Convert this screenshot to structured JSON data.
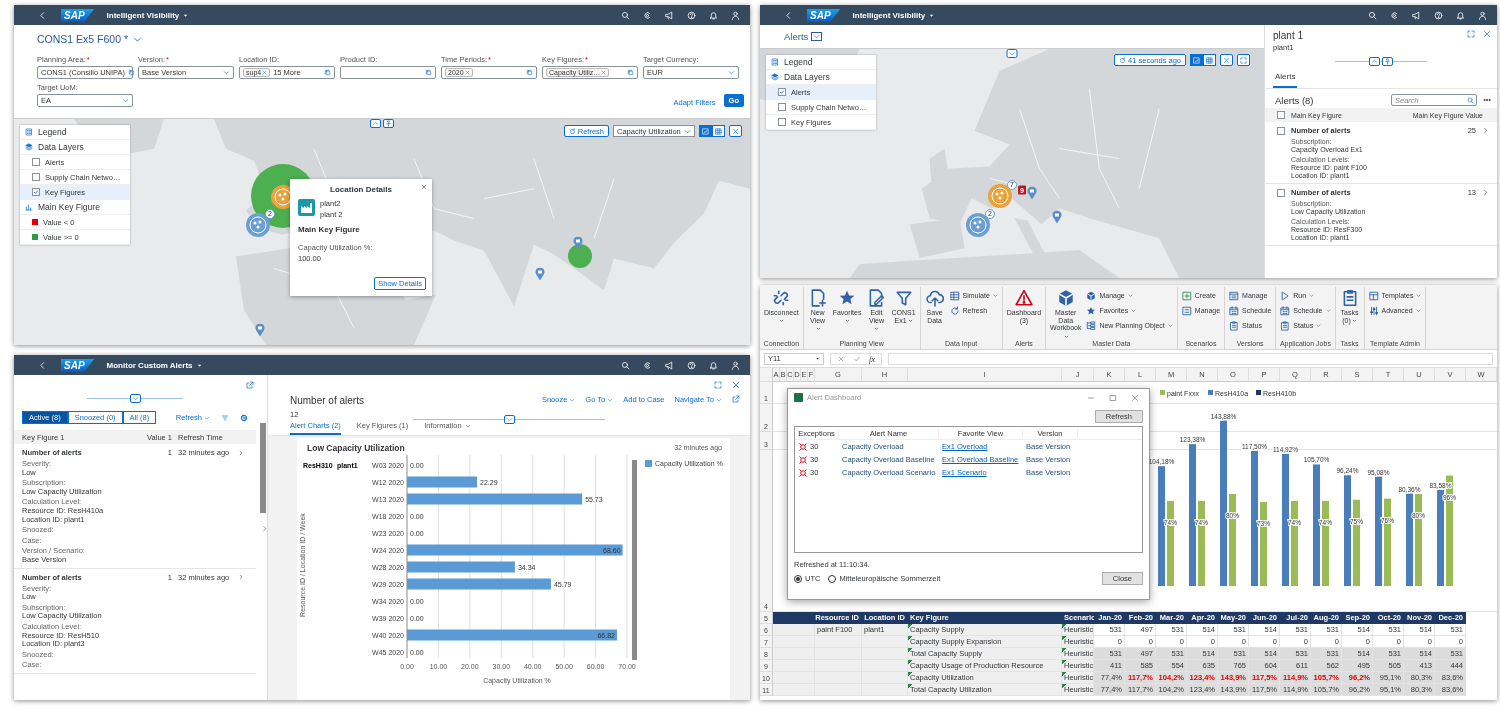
{
  "map_view": {
    "shell": {
      "logo": "SAP",
      "title": "Intelligent Visibility"
    },
    "title": "CONS1 Ex5 F600 *",
    "filters": [
      {
        "label": "Planning Area:",
        "required_mark": "*",
        "kind": "value-help",
        "value": "CONS1 (Consilio UNIPA)"
      },
      {
        "label": "Version:",
        "required_mark": "*",
        "kind": "select",
        "value": "Base Version"
      },
      {
        "label": "Location ID:",
        "kind": "tokens",
        "tokens": [
          "sup4"
        ],
        "more": "15 More"
      },
      {
        "label": "Product ID:",
        "kind": "value-help"
      },
      {
        "label": "Time Periods:",
        "required_mark": "*",
        "kind": "tokens",
        "tokens": [
          "2020"
        ]
      },
      {
        "label": "Key Figures:",
        "required_mark": "*",
        "kind": "tokens",
        "tokens": [
          "Capacity Utiliz…"
        ]
      },
      {
        "label": "Target Currency:",
        "kind": "select",
        "value": "EUR"
      },
      {
        "label": "Target UoM:",
        "kind": "select",
        "value": "EA"
      }
    ],
    "adapt_filters": "Adapt Filters",
    "go": "Go",
    "toolbar": {
      "refresh": "Refresh",
      "measure": "Capacity Utilization",
      "views": [
        {
          "kind": "chart",
          "selected": true
        },
        {
          "kind": "table",
          "selected": false
        }
      ]
    },
    "legend": {
      "title": "Legend",
      "layers_title": "Data Layers",
      "layers": [
        {
          "label": "Alerts",
          "checked": false,
          "selected": false
        },
        {
          "label": "Supply Chain Netwo…",
          "checked": false,
          "selected": false
        },
        {
          "label": "Key Figures",
          "checked": true,
          "selected": true
        }
      ],
      "key_title": "Main Key Figure",
      "keys": [
        {
          "label": "Value < 0",
          "color": "#e00000"
        },
        {
          "label": "Value >= 0",
          "color": "#2e9e44"
        }
      ]
    },
    "markers": [
      {
        "kind": "bubble",
        "color": "#4caf50"
      },
      {
        "kind": "dot",
        "color": "#4caf50"
      },
      {
        "kind": "pin",
        "color": "#5b8fc7"
      },
      {
        "kind": "cluster",
        "color": "#e8a33c"
      },
      {
        "kind": "cluster",
        "color": "#6a9fd4",
        "count": "2"
      },
      {
        "kind": "pin",
        "color": "#5b8fc7"
      },
      {
        "kind": "pin",
        "color": "#5b8fc7"
      }
    ],
    "popover": {
      "title": "Location Details",
      "name": "plant2",
      "description": "plant 2",
      "section": "Main Key Figure",
      "field": "Capacity Utilization %:",
      "value": "100.00",
      "button": "Show Details"
    }
  },
  "alerts_map": {
    "shell": {
      "logo": "SAP",
      "title": "Intelligent Visibility"
    },
    "title": "Alerts",
    "refreshed": "41 seconds ago",
    "views": [
      {
        "kind": "chart",
        "selected": true
      },
      {
        "kind": "table",
        "selected": false
      }
    ],
    "legend": {
      "title": "Legend",
      "layers_title": "Data Layers",
      "layers": [
        {
          "label": "Alerts",
          "checked": true,
          "selected": true
        },
        {
          "label": "Supply Chain Netwo…",
          "checked": false,
          "selected": false
        },
        {
          "label": "Key Figures",
          "checked": false,
          "selected": false
        }
      ]
    },
    "markers": [
      {
        "kind": "cluster",
        "color": "#e8a33c",
        "count": "7"
      },
      {
        "kind": "alert",
        "color": "#c0131d",
        "count": "9"
      },
      {
        "kind": "pin",
        "color": "#5b8fc7"
      },
      {
        "kind": "pin",
        "color": "#5b8fc7"
      },
      {
        "kind": "cluster",
        "color": "#6a9fd4",
        "count": "2"
      }
    ],
    "details": {
      "title": "plant 1",
      "subtitle": "plant1",
      "tabs": [
        {
          "label": "Alerts",
          "selected": true
        }
      ],
      "list_title": "Alerts (8)",
      "search_placeholder": "Search",
      "select_all": {
        "checked": false
      },
      "columns": [
        "Main Key Figure",
        "Main Key Figure Value"
      ],
      "items": [
        {
          "title": "Number of alerts",
          "value": "25",
          "checked": false,
          "fields": [
            {
              "label": "Subscription:",
              "values": [
                "Capacity Overload Ex1"
              ]
            },
            {
              "label": "Calculation Levels:",
              "values": [
                "Resource ID: paint F100",
                "Location ID: plant1"
              ]
            }
          ]
        },
        {
          "title": "Number of alerts",
          "value": "13",
          "checked": false,
          "fields": [
            {
              "label": "Subscription:",
              "values": [
                "Low Capacity Utilization"
              ]
            },
            {
              "label": "Calculation Levels:",
              "values": [
                "Resource ID: ResF300",
                "Location ID: plant1"
              ]
            }
          ]
        }
      ]
    }
  },
  "monitor": {
    "shell": {
      "logo": "SAP",
      "title": "Monitor Custom Alerts"
    },
    "segments": [
      {
        "label": "Active (8)",
        "selected": true
      },
      {
        "label": "Snoozed (0)",
        "selected": false
      },
      {
        "label": "All (8)",
        "selected": false
      }
    ],
    "refresh": "Refresh",
    "columns": [
      "Key Figure 1",
      "Value 1",
      "Refresh Time"
    ],
    "items": [
      {
        "title": "Number of alerts",
        "value": "1",
        "time": "32 minutes ago",
        "fields": [
          {
            "label": "Severity:",
            "values": [
              "Low"
            ]
          },
          {
            "label": "Subscription:",
            "values": [
              "Low Capacity Utilization"
            ]
          },
          {
            "label": "Calculation Level:",
            "values": [
              "Resource ID: ResH410a",
              "Location ID: plant1"
            ]
          },
          {
            "label": "Snoozed:"
          },
          {
            "label": "Case:"
          },
          {
            "label": "Version / Scenario:",
            "values": [
              "Base Version"
            ]
          }
        ]
      },
      {
        "title": "Number of alerts",
        "value": "1",
        "time": "32 minutes ago",
        "fields": [
          {
            "label": "Severity:",
            "values": [
              "Low"
            ]
          },
          {
            "label": "Subscription:",
            "values": [
              "Low Capacity Utilization"
            ]
          },
          {
            "label": "Calculation Level:",
            "values": [
              "Resource ID: ResH510",
              "Location ID: plant3"
            ]
          },
          {
            "label": "Snoozed:"
          },
          {
            "label": "Case:"
          }
        ]
      }
    ],
    "detail": {
      "title": "Number of alerts",
      "value": "12",
      "actions": [
        {
          "label": "Snooze",
          "menu": true
        },
        {
          "label": "Go To",
          "menu": true
        },
        {
          "label": "Add to Case",
          "menu": false
        },
        {
          "label": "Navigate To",
          "menu": true
        }
      ],
      "tabs": [
        {
          "label": "Alert Charts (2)",
          "selected": true,
          "menu": false
        },
        {
          "label": "Key Figures (1)",
          "selected": false,
          "menu": false
        },
        {
          "label": "Information",
          "selected": false,
          "menu": true
        }
      ],
      "chart": {
        "title": "Low Capacity Utilization",
        "timestamp": "32 minutes ago",
        "group_labels": [
          "ResH310",
          "plant1"
        ],
        "chart_data": {
          "type": "bar",
          "orientation": "horizontal",
          "xlabel": "Capacity Utilization %",
          "ylabel": "Resource ID / Location ID / Week",
          "categories": [
            "W03 2020",
            "W12 2020",
            "W13 2020",
            "W18 2020",
            "W23 2020",
            "W24 2020",
            "W28 2020",
            "W29 2020",
            "W34 2020",
            "W39 2020",
            "W40 2020",
            "W45 2020"
          ],
          "series": [
            {
              "name": "Capacity Utilization %",
              "color": "#5b9bd5",
              "values": [
                0,
                22.29,
                55.73,
                0,
                0,
                68.6,
                34.34,
                45.79,
                0,
                0,
                66.82,
                0
              ],
              "value_labels": [
                "0.00",
                "22.29",
                "55.73",
                "0.00",
                "0.00",
                "68.60",
                "34.34",
                "45.79",
                "0.00",
                "0.00",
                "66.82",
                "0.00"
              ]
            }
          ],
          "xlim": [
            0,
            70
          ],
          "xticks": [
            {
              "value": 0,
              "label": "0.00"
            },
            {
              "value": 10,
              "label": "10.00"
            },
            {
              "value": 20,
              "label": "20.00"
            },
            {
              "value": 30,
              "label": "30.00"
            },
            {
              "value": 40,
              "label": "40.00"
            },
            {
              "value": 50,
              "label": "50.00"
            },
            {
              "value": 60,
              "label": "60.00"
            },
            {
              "value": 70,
              "label": "70.00"
            }
          ],
          "grid": true,
          "data_labels": true
        }
      }
    }
  },
  "excel": {
    "ribbon": [
      {
        "name": "Connection",
        "items": [
          {
            "label": "Disconnect",
            "large": true,
            "menu": true,
            "kind": "unlink"
          }
        ]
      },
      {
        "name": "Planning View",
        "items": [
          {
            "label": "New View",
            "large": true,
            "menu": true,
            "kind": "newdoc"
          },
          {
            "label": "Favorites",
            "large": true,
            "menu": true,
            "kind": "star"
          },
          {
            "label": "Edit View",
            "large": true,
            "menu": true,
            "kind": "edit"
          },
          {
            "label": "CONS1 Ex1",
            "large": true,
            "menu": true,
            "kind": "funnel"
          }
        ]
      },
      {
        "name": "Data Input",
        "items": [
          {
            "label": "Save Data",
            "large": true,
            "menu": false,
            "kind": "upload"
          },
          {
            "label": "Simulate",
            "large": false,
            "menu": true,
            "kind": "sheet"
          },
          {
            "label": "Refresh",
            "large": false,
            "menu": false,
            "kind": "refresh"
          }
        ]
      },
      {
        "name": "Alerts",
        "items": [
          {
            "label": "Dashboard (3)",
            "large": true,
            "menu": false,
            "kind": "warning"
          }
        ]
      },
      {
        "name": "Master Data",
        "items": [
          {
            "label": "Master Data Workbook",
            "large": true,
            "menu": true,
            "kind": "cube"
          },
          {
            "label": "Manage",
            "large": false,
            "menu": true,
            "kind": "cube"
          },
          {
            "label": "Favorites",
            "large": false,
            "menu": true,
            "kind": "star"
          },
          {
            "label": "New Planning Object",
            "large": false,
            "menu": true,
            "kind": "tree"
          }
        ]
      },
      {
        "name": "Scenarios",
        "items": [
          {
            "label": "Create",
            "large": false,
            "menu": false,
            "kind": "create"
          },
          {
            "label": "Manage",
            "large": false,
            "menu": false,
            "kind": "scenario"
          }
        ]
      },
      {
        "name": "Versions",
        "items": [
          {
            "label": "Manage",
            "large": false,
            "menu": false,
            "kind": "form"
          },
          {
            "label": "Schedule",
            "large": false,
            "menu": false,
            "kind": "calendar"
          },
          {
            "label": "Status",
            "large": false,
            "menu": false,
            "kind": "clipboard"
          }
        ]
      },
      {
        "name": "Application Jobs",
        "items": [
          {
            "label": "Run",
            "large": false,
            "menu": true,
            "kind": "play"
          },
          {
            "label": "Schedule",
            "large": false,
            "menu": true,
            "kind": "calendar"
          },
          {
            "label": "Status",
            "large": false,
            "menu": true,
            "kind": "clipboard"
          }
        ]
      },
      {
        "name": "Tasks",
        "items": [
          {
            "label": "Tasks (0)",
            "large": true,
            "menu": true,
            "kind": "clipboard"
          }
        ]
      },
      {
        "name": "Template Admin",
        "items": [
          {
            "label": "Templates",
            "large": false,
            "menu": true,
            "kind": "template"
          },
          {
            "label": "Advanced",
            "large": false,
            "menu": true,
            "kind": "sliders"
          }
        ]
      }
    ],
    "name_box": "Y11",
    "function_label": "fx",
    "columns": [
      "A",
      "B",
      "C",
      "D",
      "E",
      "F",
      "G",
      "H",
      "I",
      "J",
      "K",
      "L",
      "M",
      "N",
      "O",
      "P",
      "Q",
      "R",
      "S",
      "T",
      "U",
      "V",
      "W"
    ],
    "row_numbers": [
      "1",
      "2",
      "3",
      "4",
      "5",
      "6",
      "7",
      "8",
      "9",
      "10",
      "11"
    ],
    "table": {
      "header": [
        "Resource ID",
        "Location ID",
        "Key Figure",
        "Scenario",
        "Jan-20",
        "Feb-20",
        "Mar-20",
        "Apr-20",
        "May-20",
        "Jun-20",
        "Jul-20",
        "Aug-20",
        "Sep-20",
        "Oct-20",
        "Nov-20",
        "Dec-20"
      ],
      "rows": [
        {
          "resource": "paint F100",
          "location": "plant1",
          "key_figure": "Capacity Supply",
          "scenario": "Heuristic",
          "editable": true,
          "values": [
            "531",
            "497",
            "531",
            "514",
            "531",
            "514",
            "531",
            "531",
            "514",
            "531",
            "514",
            "531"
          ],
          "alerts": [
            false,
            false,
            false,
            false,
            false,
            false,
            false,
            false,
            false,
            false,
            false,
            false
          ]
        },
        {
          "key_figure": "Capacity Supply Expansion",
          "scenario": "Heuristic",
          "editable": true,
          "values": [
            "0",
            "0",
            "0",
            "0",
            "0",
            "0",
            "0",
            "0",
            "0",
            "0",
            "0",
            "0"
          ],
          "alerts": [
            false,
            false,
            false,
            false,
            false,
            false,
            false,
            false,
            false,
            false,
            false,
            false
          ]
        },
        {
          "key_figure": "Total Capacity Supply",
          "scenario": "Heuristic",
          "editable": false,
          "values": [
            "531",
            "497",
            "531",
            "514",
            "531",
            "514",
            "531",
            "531",
            "514",
            "531",
            "514",
            "531"
          ],
          "alerts": [
            false,
            false,
            false,
            false,
            false,
            false,
            false,
            false,
            false,
            false,
            false,
            false
          ]
        },
        {
          "key_figure": "Capacity Usage of Production Resource",
          "scenario": "Heuristic",
          "editable": false,
          "values": [
            "411",
            "585",
            "554",
            "635",
            "765",
            "604",
            "611",
            "562",
            "495",
            "505",
            "413",
            "444"
          ],
          "alerts": [
            false,
            false,
            false,
            false,
            false,
            false,
            false,
            false,
            false,
            false,
            false,
            false
          ]
        },
        {
          "key_figure": "Capacity Utilization",
          "scenario": "Heuristic",
          "editable": false,
          "values": [
            "77,4%",
            "117,7%",
            "104,2%",
            "123,4%",
            "143,9%",
            "117,5%",
            "114,9%",
            "105,7%",
            "96,2%",
            "95,1%",
            "80,3%",
            "83,6%"
          ],
          "alerts": [
            false,
            true,
            true,
            true,
            true,
            true,
            true,
            true,
            true,
            false,
            false,
            false
          ]
        },
        {
          "key_figure": "Total Capacity Utilization",
          "scenario": "Heuristic",
          "editable": false,
          "values": [
            "77,4%",
            "117,7%",
            "104,2%",
            "123,4%",
            "143,9%",
            "117,5%",
            "114,9%",
            "105,7%",
            "96,2%",
            "95,1%",
            "80,3%",
            "83,6%"
          ],
          "alerts": [
            false,
            false,
            false,
            false,
            false,
            false,
            false,
            false,
            false,
            false,
            false,
            false
          ]
        }
      ]
    },
    "chart": {
      "extra_legend": [
        {
          "label": "ResH410b",
          "color": "#1f3864"
        }
      ],
      "chart_data": {
        "type": "bar",
        "legend": "top",
        "data_labels": true,
        "categories": [
          null,
          null,
          null,
          null,
          null,
          null,
          null,
          null,
          null,
          null
        ],
        "series": [
          {
            "name": "paint Fxxx",
            "color": "#9bbb59",
            "values": [
              74,
              74,
              80,
              73,
              74,
              74,
              75,
              76,
              80,
              96
            ],
            "value_labels": [
              "74%",
              "74%",
              "80%",
              "73%",
              "74%",
              "74%",
              "75%",
              "76%",
              "80%",
              "96%"
            ]
          },
          {
            "name": "ResH410a",
            "color": "#4a7ebb",
            "values": [
              104.18,
              123.38,
              143.88,
              117.5,
              114.92,
              105.7,
              96.24,
              95.08,
              80.36,
              83.58
            ],
            "value_labels": [
              "104,18%",
              "123,38%",
              "143,88%",
              "117,50%",
              "114,92%",
              "105,70%",
              "96,24%",
              "95,08%",
              "80,36%",
              "83,58%"
            ]
          }
        ]
      }
    },
    "dialog": {
      "title": "Alert Dashboard",
      "refresh": "Refresh",
      "columns": [
        "Exceptions",
        "Alert Name",
        "Favorite View",
        "Version"
      ],
      "rows": [
        {
          "count": "30",
          "name": "Capacity Overload",
          "view": "Ex1 Overload",
          "version": "Base Version"
        },
        {
          "count": "30",
          "name": "Capacity Overload Baseline",
          "view": "Ex1 Overload Baseline",
          "version": "Base Version"
        },
        {
          "count": "30",
          "name": "Capacity Overload Scenario",
          "view": "Ex1 Scenario",
          "version": "Base Version"
        }
      ],
      "status": "Refreshed at 11:10:34.",
      "timezones": [
        {
          "label": "UTC",
          "selected": true
        },
        {
          "label": "Mitteleuropäische Sommerzeit",
          "selected": false
        }
      ],
      "close": "Close"
    }
  }
}
